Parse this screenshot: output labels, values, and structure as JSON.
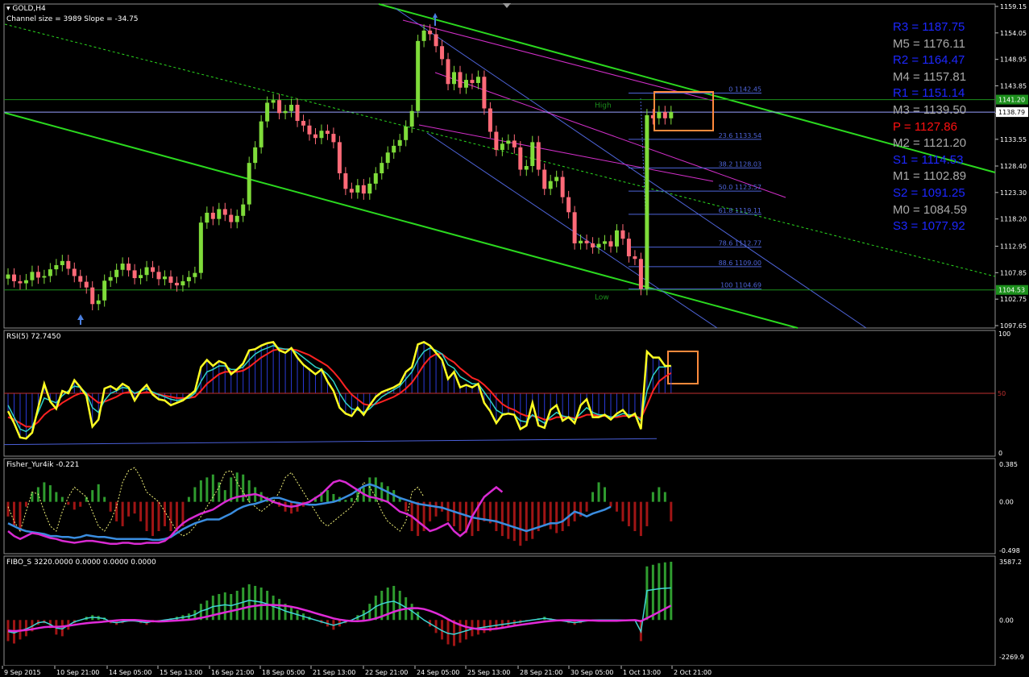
{
  "window": {
    "symbol_label": "GOLD,H4",
    "channel_info": "Channel size = 3989 Slope = -34.75",
    "menu_arrow_icon": "triangle-down-icon"
  },
  "colors": {
    "background": "#000000",
    "bull": "#7fdc3a",
    "bear": "#ff6a78",
    "channel": "#2bd91f",
    "fib": "#4e64d8",
    "magenta": "#d22fc9",
    "highlight": "#ff8a3c",
    "rsi": "#ffff22",
    "rsi_slow": "#ff2222",
    "pivot_r": "#1d27ff",
    "pivot_m": "#a9a9a9",
    "pivot_p": "#ff1010"
  },
  "pivots": [
    {
      "label": "R3 = 1187.75",
      "kind": "r"
    },
    {
      "label": "M5 = 1176.11",
      "kind": "m"
    },
    {
      "label": "R2 = 1164.47",
      "kind": "r"
    },
    {
      "label": "M4 = 1157.81",
      "kind": "m"
    },
    {
      "label": "R1 = 1151.14",
      "kind": "r"
    },
    {
      "label": "M3 = 1139.50",
      "kind": "m"
    },
    {
      "label": "P  = 1127.86",
      "kind": "p"
    },
    {
      "label": "M2 = 1121.20",
      "kind": "m"
    },
    {
      "label": "S1 = 1114.53",
      "kind": "r"
    },
    {
      "label": "M1 = 1102.89",
      "kind": "m"
    },
    {
      "label": "S2 = 1091.25",
      "kind": "r"
    },
    {
      "label": "M0 = 1084.59",
      "kind": "m"
    },
    {
      "label": "S3 = 1077.92",
      "kind": "r"
    }
  ],
  "chart_data": [
    {
      "name": "GOLD,H4",
      "type": "candlestick",
      "ylim": [
        1097.65,
        1159.15
      ],
      "y_ticks": [
        "1159.15",
        "1154.05",
        "1148.95",
        "1143.85",
        "1138.60",
        "1133.55",
        "1128.40",
        "1123.30",
        "1118.20",
        "1112.95",
        "1107.85",
        "1102.75",
        "1097.65"
      ],
      "price_tags": [
        "1141.20",
        "1138.79",
        "1104.53"
      ],
      "level_labels": [
        "High",
        "Low"
      ],
      "fib_levels": [
        {
          "label": "0 1142.45",
          "value": 1142.45
        },
        {
          "label": "23.6 1133.54",
          "value": 1133.54
        },
        {
          "label": "38.2 1128.03",
          "value": 1128.03
        },
        {
          "label": "50.0 1123.57",
          "value": 1123.57
        },
        {
          "label": "61.8 1119.11",
          "value": 1119.11
        },
        {
          "label": "78.6 1112.77",
          "value": 1112.77
        },
        {
          "label": "88.6 1109.00",
          "value": 1109.0
        },
        {
          "label": "100 1104.69",
          "value": 1104.69
        }
      ],
      "close": [
        1107.5,
        1106.2,
        1105.8,
        1106.4,
        1108.0,
        1106.9,
        1107.2,
        1108.5,
        1109.3,
        1110.1,
        1108.6,
        1107.2,
        1106.1,
        1105.0,
        1101.8,
        1102.5,
        1106.3,
        1107.0,
        1108.4,
        1109.6,
        1108.3,
        1106.8,
        1107.4,
        1108.9,
        1108.0,
        1106.6,
        1107.1,
        1105.9,
        1105.4,
        1106.2,
        1107.0,
        1107.8,
        1117.5,
        1119.4,
        1118.2,
        1120.1,
        1119.0,
        1117.6,
        1118.8,
        1121.0,
        1129.0,
        1132.0,
        1137.0,
        1140.6,
        1141.1,
        1138.6,
        1139.0,
        1140.2,
        1137.1,
        1136.2,
        1134.5,
        1133.8,
        1135.2,
        1134.6,
        1133.0,
        1127.0,
        1124.0,
        1123.3,
        1124.7,
        1123.1,
        1125.0,
        1127.0,
        1129.0,
        1131.0,
        1132.3,
        1133.4,
        1136.0,
        1139.0,
        1152.5,
        1154.5,
        1153.8,
        1151.5,
        1149.0,
        1144.2,
        1146.5,
        1143.5,
        1145.0,
        1144.4,
        1145.6,
        1139.5,
        1135.0,
        1131.5,
        1132.7,
        1133.3,
        1132.0,
        1127.7,
        1128.4,
        1133.0,
        1127.7,
        1124.0,
        1125.5,
        1126.3,
        1122.4,
        1119.5,
        1113.5,
        1114.0,
        1113.5,
        1112.7,
        1113.4,
        1113.9,
        1112.9,
        1116.0,
        1114.4,
        1111.0,
        1110.5,
        1104.7,
        1138.2,
        1137.6,
        1138.8,
        1137.6,
        1138.8
      ],
      "x_labels": [
        "9 Sep 2015",
        "10 Sep 21:00",
        "14 Sep 05:00",
        "15 Sep 13:00",
        "16 Sep 21:00",
        "18 Sep 05:00",
        "21 Sep 13:00",
        "22 Sep 21:00",
        "24 Sep 05:00",
        "25 Sep 13:00",
        "28 Sep 21:00",
        "30 Sep 05:00",
        "1 Oct 13:00",
        "2 Oct 21:00"
      ]
    },
    {
      "name": "RSI(5)",
      "type": "line",
      "header": "RSI(5) 72.7450",
      "ylim": [
        0,
        100
      ],
      "y_ticks": [
        "100",
        "0"
      ],
      "mid_label": "50",
      "rsi": [
        35,
        25,
        13,
        12,
        17,
        38,
        58,
        43,
        37,
        52,
        50,
        61,
        55,
        48,
        22,
        28,
        54,
        56,
        53,
        58,
        55,
        44,
        52,
        57,
        49,
        45,
        44,
        40,
        42,
        44,
        48,
        52,
        72,
        78,
        73,
        77,
        75,
        66,
        70,
        75,
        86,
        87,
        90,
        92,
        93,
        86,
        84,
        88,
        80,
        74,
        70,
        66,
        70,
        60,
        52,
        38,
        33,
        31,
        38,
        32,
        40,
        47,
        51,
        53,
        55,
        58,
        68,
        72,
        91,
        93,
        90,
        84,
        78,
        62,
        68,
        55,
        57,
        55,
        58,
        42,
        35,
        25,
        32,
        33,
        32,
        20,
        23,
        42,
        23,
        21,
        36,
        40,
        27,
        30,
        25,
        40,
        45,
        30,
        30,
        32,
        28,
        33,
        36,
        30,
        33,
        20,
        85,
        80,
        80,
        73,
        73
      ],
      "rsi_fast_ma": [
        40,
        30,
        20,
        18,
        22,
        34,
        46,
        44,
        42,
        48,
        52,
        56,
        55,
        50,
        38,
        34,
        44,
        50,
        52,
        55,
        54,
        50,
        52,
        54,
        51,
        49,
        47,
        45,
        44,
        45,
        46,
        50,
        60,
        68,
        70,
        73,
        73,
        70,
        70,
        72,
        78,
        83,
        86,
        88,
        90,
        88,
        87,
        87,
        84,
        80,
        76,
        72,
        70,
        66,
        60,
        50,
        42,
        37,
        36,
        34,
        37,
        42,
        47,
        50,
        53,
        56,
        62,
        68,
        78,
        85,
        88,
        86,
        83,
        74,
        71,
        64,
        61,
        58,
        58,
        51,
        44,
        36,
        33,
        33,
        32,
        27,
        26,
        32,
        28,
        25,
        30,
        34,
        31,
        30,
        28,
        33,
        38,
        34,
        32,
        32,
        30,
        31,
        33,
        32,
        32,
        27,
        52,
        65,
        72,
        72,
        73
      ],
      "rsi_slow_ma": [
        30,
        28,
        25,
        22,
        22,
        26,
        32,
        36,
        38,
        42,
        45,
        48,
        50,
        50,
        46,
        42,
        43,
        45,
        47,
        50,
        51,
        50,
        50,
        51,
        50,
        49,
        48,
        47,
        46,
        46,
        46,
        47,
        52,
        58,
        62,
        66,
        68,
        68,
        68,
        69,
        72,
        76,
        80,
        83,
        86,
        87,
        87,
        87,
        86,
        84,
        82,
        79,
        76,
        73,
        68,
        62,
        55,
        49,
        45,
        41,
        40,
        41,
        43,
        45,
        47,
        50,
        54,
        59,
        66,
        74,
        80,
        83,
        83,
        79,
        76,
        71,
        67,
        63,
        61,
        57,
        52,
        46,
        41,
        38,
        36,
        33,
        31,
        31,
        30,
        28,
        28,
        30,
        30,
        30,
        29,
        30,
        32,
        32,
        31,
        31,
        30,
        30,
        31,
        31,
        31,
        29,
        40,
        52,
        60,
        64,
        67
      ]
    },
    {
      "name": "Fisher_Yur4ik",
      "type": "bar",
      "header": "Fisher_Yur4ik -0.221",
      "ylim": [
        -0.498,
        0.385
      ],
      "y_ticks": [
        "0.385",
        "0.00",
        "-0.498"
      ],
      "values": [
        -0.15,
        -0.25,
        -0.3,
        -0.05,
        0.1,
        0.15,
        0.2,
        0.17,
        0.1,
        0.05,
        -0.03,
        -0.08,
        -0.05,
        0.05,
        0.12,
        0.18,
        0.05,
        -0.1,
        -0.2,
        -0.25,
        -0.15,
        -0.12,
        -0.2,
        -0.3,
        -0.35,
        -0.3,
        -0.25,
        -0.3,
        -0.3,
        -0.25,
        0.05,
        0.15,
        0.22,
        0.25,
        0.28,
        0.2,
        0.12,
        0.25,
        0.3,
        0.28,
        0.22,
        0.15,
        0.1,
        0.05,
        0.02,
        -0.05,
        -0.1,
        -0.12,
        -0.1,
        -0.05,
        0.0,
        0.05,
        0.1,
        0.12,
        0.08,
        0.05,
        0.02,
        0.04,
        0.1,
        0.15,
        0.25,
        0.25,
        0.2,
        0.16,
        0.12,
        0.05,
        -0.1,
        -0.3,
        -0.35,
        -0.3,
        -0.2,
        -0.15,
        -0.1,
        -0.2,
        -0.25,
        -0.3,
        -0.32,
        -0.35,
        -0.3,
        -0.2,
        -0.22,
        -0.3,
        -0.35,
        -0.38,
        -0.4,
        -0.45,
        -0.4,
        -0.38,
        -0.3,
        -0.25,
        -0.28,
        -0.32,
        -0.3,
        -0.25,
        -0.2,
        -0.15,
        -0.1,
        0.1,
        0.2,
        0.15,
        -0.05,
        -0.1,
        -0.2,
        -0.25,
        -0.3,
        -0.35,
        -0.25,
        0.1,
        0.15,
        0.1,
        -0.2
      ],
      "signal": [
        -0.22,
        -0.25,
        -0.28,
        -0.3,
        -0.31,
        -0.32,
        -0.33,
        -0.35,
        -0.35,
        -0.36,
        -0.36,
        -0.37,
        -0.36,
        -0.34,
        -0.35,
        -0.36,
        -0.36,
        -0.37,
        -0.38,
        -0.38,
        -0.38,
        -0.38,
        -0.38,
        -0.38,
        -0.39,
        -0.39,
        -0.38,
        -0.36,
        -0.32,
        -0.28,
        -0.25,
        -0.22,
        -0.2,
        -0.18,
        -0.18,
        -0.18,
        -0.15,
        -0.12,
        -0.08,
        -0.05,
        -0.03,
        -0.02,
        0.0,
        0.02,
        0.04,
        0.04,
        0.02,
        0.0,
        -0.01,
        -0.02,
        -0.03,
        -0.03,
        -0.02,
        -0.01,
        0.0,
        0.02,
        0.05,
        0.08,
        0.12,
        0.16,
        0.18,
        0.16,
        0.13,
        0.1,
        0.07,
        0.04,
        0.02,
        0.0,
        -0.02,
        -0.03,
        -0.04,
        -0.05,
        -0.06,
        -0.08,
        -0.1,
        -0.12,
        -0.14,
        -0.16,
        -0.17,
        -0.18,
        -0.19,
        -0.2,
        -0.22,
        -0.24,
        -0.26,
        -0.28,
        -0.3,
        -0.28,
        -0.26,
        -0.24,
        -0.22,
        -0.22,
        -0.2,
        -0.15,
        -0.1,
        -0.12,
        -0.15,
        -0.12,
        -0.1,
        -0.08,
        -0.05
      ],
      "signal_fast": [
        -0.3,
        -0.35,
        -0.38,
        -0.35,
        -0.32,
        -0.33,
        -0.35,
        -0.37,
        -0.38,
        -0.4,
        -0.41,
        -0.42,
        -0.41,
        -0.4,
        -0.4,
        -0.41,
        -0.42,
        -0.43,
        -0.43,
        -0.42,
        -0.42,
        -0.43,
        -0.43,
        -0.42,
        -0.42,
        -0.42,
        -0.4,
        -0.35,
        -0.28,
        -0.22,
        -0.18,
        -0.15,
        -0.12,
        -0.1,
        -0.08,
        -0.04,
        0.0,
        0.03,
        0.05,
        0.06,
        0.07,
        0.08,
        0.06,
        0.03,
        0.0,
        -0.02,
        -0.04,
        -0.05,
        -0.04,
        -0.02,
        0.0,
        0.04,
        0.08,
        0.14,
        0.2,
        0.22,
        0.2,
        0.16,
        0.12,
        0.08,
        0.05,
        0.04,
        0.02,
        0.0,
        -0.05,
        -0.1,
        -0.12,
        -0.15,
        -0.2,
        -0.25,
        -0.3,
        -0.28,
        -0.25,
        -0.22,
        -0.3,
        -0.35,
        -0.3,
        -0.15,
        -0.05,
        0.05,
        0.1,
        0.15,
        0.1
      ],
      "signal_dotted": [
        -0.05,
        -0.2,
        -0.3,
        -0.1,
        0.1,
        0.08,
        -0.1,
        -0.25,
        -0.3,
        -0.1,
        0.05,
        0.15,
        0.1,
        0.05,
        -0.1,
        -0.25,
        -0.3,
        -0.2,
        -0.05,
        0.2,
        0.32,
        0.35,
        0.25,
        0.1,
        0.05,
        0.0,
        -0.1,
        -0.2,
        -0.3,
        -0.35,
        -0.32,
        -0.25,
        -0.15,
        -0.05,
        0.05,
        0.15,
        0.3,
        0.32,
        0.2,
        0.1,
        0.0,
        -0.05,
        -0.1,
        -0.05,
        0.0,
        0.1,
        0.25,
        0.3,
        0.2,
        0.1,
        0.0,
        -0.1,
        -0.2,
        -0.25,
        -0.2,
        -0.15,
        -0.1,
        -0.05,
        0.05,
        0.2,
        0.15,
        0.05,
        -0.1,
        -0.2,
        -0.25,
        -0.3,
        -0.2,
        0.1,
        0.15,
        0.05
      ]
    },
    {
      "name": "FIBO_S",
      "type": "bar",
      "header": "FIBO_S 3220.0000 0.0000 0.0000 0.0000",
      "ylim": [
        -2269.9,
        3587.2
      ],
      "y_ticks": [
        "3587.2",
        "0.00",
        "-2269.9"
      ],
      "values": [
        -1300,
        -1450,
        -1200,
        -1000,
        -700,
        -300,
        -200,
        -500,
        -900,
        -1000,
        -600,
        -200,
        0,
        200,
        300,
        250,
        150,
        -200,
        -300,
        -200,
        -100,
        -100,
        -200,
        -300,
        -150,
        -100,
        0,
        100,
        200,
        300,
        400,
        600,
        1000,
        1200,
        1500,
        1600,
        1700,
        1600,
        1800,
        2000,
        2200,
        2100,
        2000,
        1800,
        1500,
        1300,
        1000,
        800,
        600,
        400,
        200,
        0,
        -200,
        -400,
        -600,
        -400,
        -200,
        0,
        300,
        600,
        1000,
        1500,
        1800,
        2000,
        2100,
        1800,
        1400,
        1000,
        500,
        0,
        -400,
        -800,
        -1200,
        -1500,
        -1600,
        -1400,
        -1200,
        -1000,
        -900,
        -800,
        -700,
        -600,
        -500,
        -400,
        -300,
        -200,
        -100,
        0,
        100,
        200,
        100,
        0,
        -100,
        -200,
        -300,
        -200,
        -100,
        0,
        0,
        0,
        0,
        0,
        0,
        0,
        0,
        -1300,
        3300,
        3400,
        3500,
        3550,
        3587
      ]
    }
  ]
}
